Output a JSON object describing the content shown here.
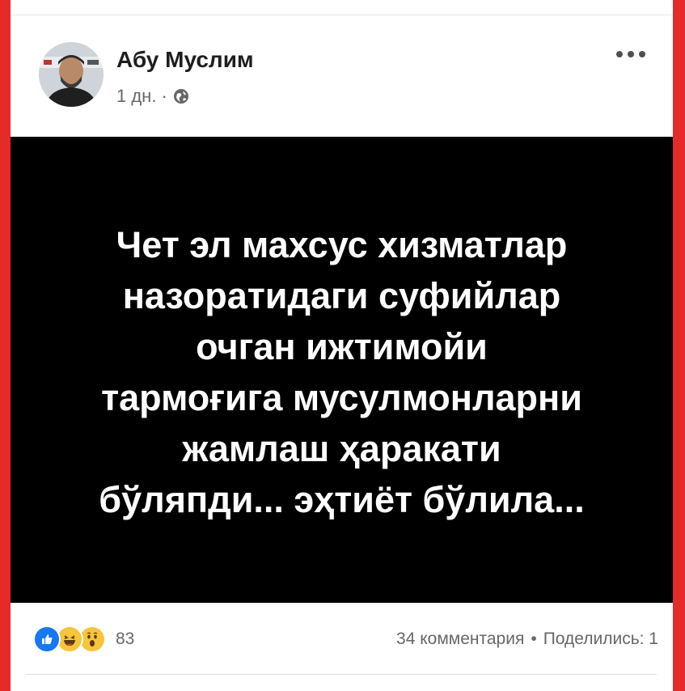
{
  "post": {
    "author": "Абу Муслим",
    "time": "1 дн.",
    "separator": "·",
    "privacy_icon": "globe-icon",
    "more_icon": "more-dots-icon",
    "image_text_lines": [
      "Чет эл махсус хизматлар",
      "назоратидаги суфийлар",
      "очган ижтимойи",
      "тармоғига мусулмонларни",
      "жамлаш ҳаракати",
      "бўляпди... эҳтиёт бўлила..."
    ],
    "reactions": {
      "icons": [
        "like-icon",
        "haha-icon",
        "wow-icon"
      ],
      "count": "83"
    },
    "comments": "34 комментария",
    "stats_separator": "•",
    "shares": "Поделились: 1"
  },
  "colors": {
    "frame": "#e52a2a",
    "image_background": "#000000",
    "image_text": "#ffffff",
    "like_blue": "#1877f2",
    "emoji_yellow": "#f7c43c",
    "meta_gray": "#65676b"
  }
}
